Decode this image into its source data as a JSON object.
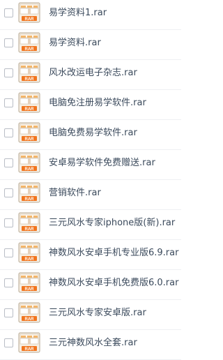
{
  "file_list": {
    "icon": "rar-archive-icon",
    "icon_badge_label": "RAR",
    "items": [
      {
        "name": "易学资料1.rar"
      },
      {
        "name": "易学资料.rar"
      },
      {
        "name": "风水改运电子杂志.rar"
      },
      {
        "name": "电脑免注册易学软件.rar"
      },
      {
        "name": "电脑免费易学软件.rar"
      },
      {
        "name": "安卓易学软件免费赠送.rar"
      },
      {
        "name": "营销软件.rar"
      },
      {
        "name": "三元风水专家iphone版(新).rar"
      },
      {
        "name": "神数风水安卓手机专业版6.9.rar"
      },
      {
        "name": "神数风水安卓手机免费版6.0.rar"
      },
      {
        "name": "三元风水专家安卓版.rar"
      },
      {
        "name": "三元神数风水全套.rar"
      }
    ]
  }
}
